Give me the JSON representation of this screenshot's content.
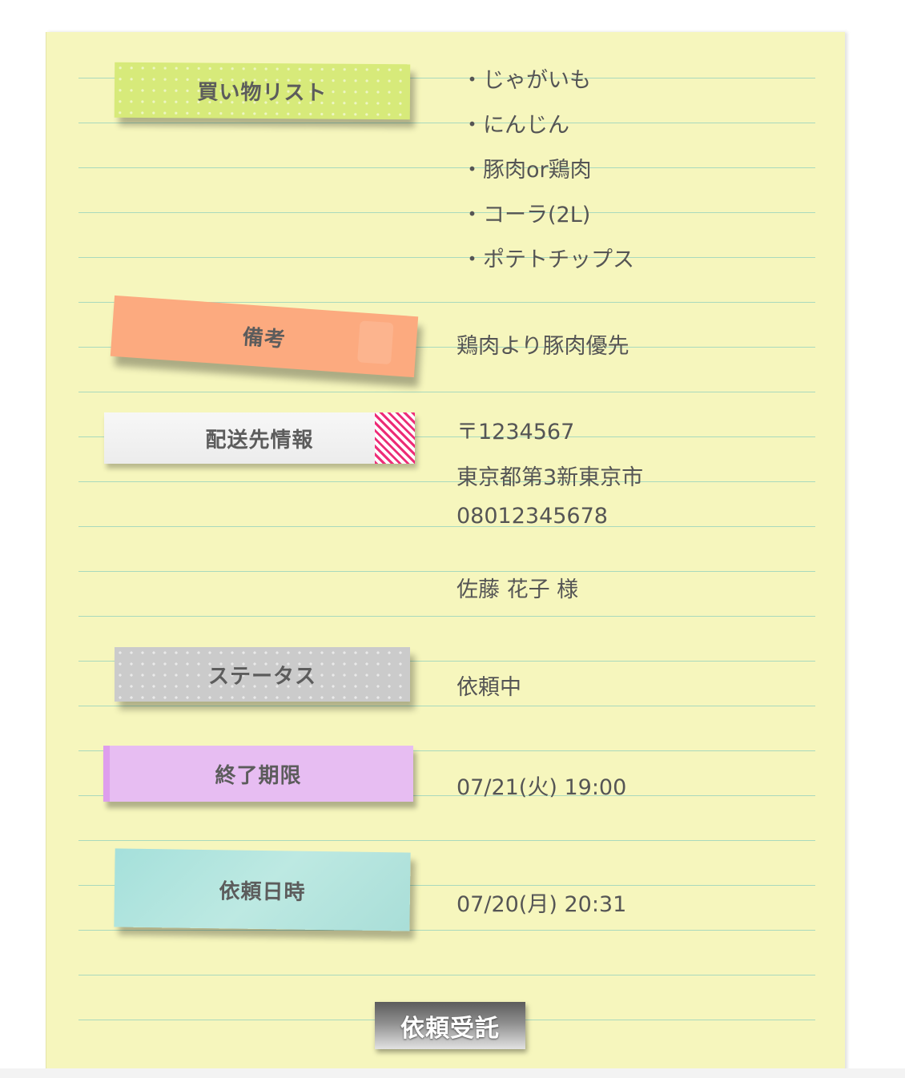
{
  "colors": {
    "paper": "#f6f6bd",
    "rule_line": "#a9d9bd",
    "text": "#555555",
    "tape_shopping": "#d7ea7a",
    "tape_notes": "#fcaa7f",
    "tape_delivery": "#f3f3f3",
    "tape_delivery_stripe": "#ee2d78",
    "tape_status": "#cbcbcb",
    "tape_deadline": "#e7bdf2",
    "tape_requested": "#aee3dd"
  },
  "shopping_list": {
    "label": "買い物リスト",
    "items": [
      "・じゃがいも",
      "・にんじん",
      "・豚肉or鶏肉",
      "・コーラ(2L)",
      "・ポテトチップス"
    ]
  },
  "notes": {
    "label": "備考",
    "value": "鶏肉より豚肉優先"
  },
  "delivery": {
    "label": "配送先情報",
    "postal": "〒1234567",
    "address": "東京都第3新東京市",
    "phone": "08012345678",
    "name": "佐藤 花子 様"
  },
  "status": {
    "label": "ステータス",
    "value": "依頼中"
  },
  "deadline": {
    "label": "終了期限",
    "value": "07/21(火) 19:00"
  },
  "requested_at": {
    "label": "依頼日時",
    "value": "07/20(月) 20:31"
  },
  "action": {
    "accept_label": "依頼受託"
  }
}
